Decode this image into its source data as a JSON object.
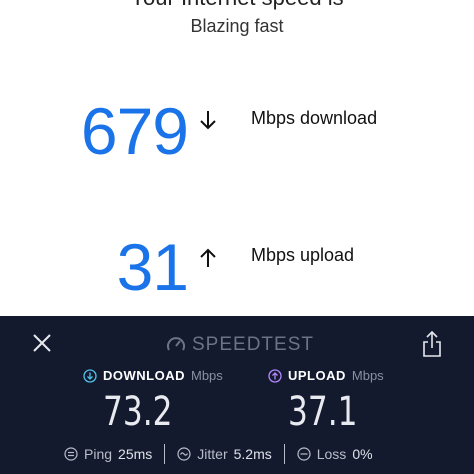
{
  "results": {
    "cut_title": "Your Internet speed is",
    "subtitle": "Blazing fast",
    "download": {
      "value": "679",
      "label": "Mbps download"
    },
    "upload": {
      "value": "31",
      "label": "Mbps upload"
    }
  },
  "speedtest": {
    "brand": "SPEEDTEST",
    "download": {
      "title": "DOWNLOAD",
      "unit": "Mbps",
      "value": "73.2"
    },
    "upload": {
      "title": "UPLOAD",
      "unit": "Mbps",
      "value": "37.1"
    },
    "stats": {
      "ping_label": "Ping",
      "ping_value": "25ms",
      "jitter_label": "Jitter",
      "jitter_value": "5.2ms",
      "loss_label": "Loss",
      "loss_value": "0%"
    }
  },
  "icons": {
    "download_arrow": "arrow-down-icon",
    "upload_arrow": "arrow-up-icon",
    "close": "close-icon",
    "share": "share-icon",
    "gauge": "speedometer-icon"
  },
  "colors": {
    "accent_blue": "#1a73e8",
    "panel_bg": "#141a2e",
    "download_cyan": "#4fc3e8",
    "upload_purple": "#b388ff"
  }
}
